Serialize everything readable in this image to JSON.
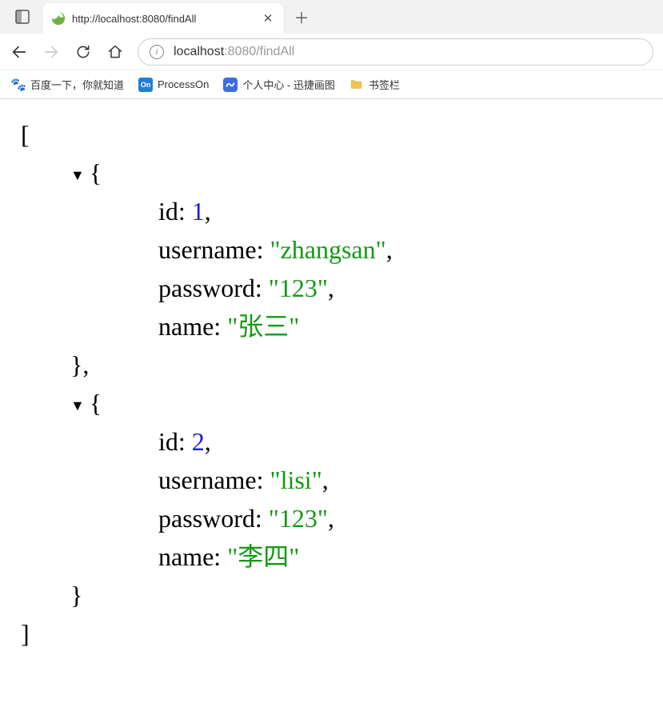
{
  "browser": {
    "tab_title": "http://localhost:8080/findAll",
    "url_host_prefix": "localhost",
    "url_port_path": ":8080/findAll",
    "bookmarks": [
      {
        "label": "百度一下，你就知道"
      },
      {
        "label": "ProcessOn"
      },
      {
        "label": "个人中心 - 迅捷画图"
      },
      {
        "label": "书签栏"
      }
    ]
  },
  "json_response": [
    {
      "id": 1,
      "username": "zhangsan",
      "password": "123",
      "name": "张三"
    },
    {
      "id": 2,
      "username": "lisi",
      "password": "123",
      "name": "李四"
    }
  ],
  "labels": {
    "id": "id",
    "username": "username",
    "password": "password",
    "name": "name"
  }
}
